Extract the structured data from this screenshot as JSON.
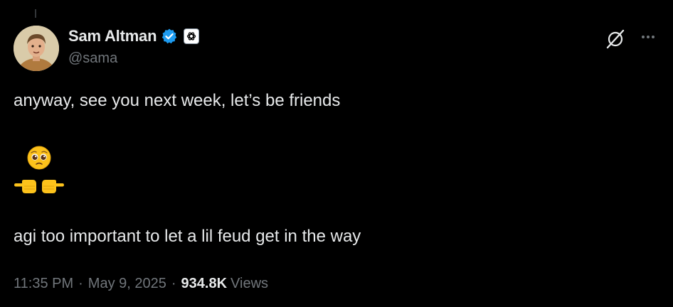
{
  "author": {
    "display_name": "Sam Altman",
    "handle": "@sama",
    "verified_badge_color": "#1d9bf0",
    "avatar_icon": "avatar",
    "affiliate_icon": "openai-logo-icon"
  },
  "header_actions": {
    "grok_icon": "grok-icon",
    "more_icon": "more-icon"
  },
  "tweet": {
    "line1": "anyway, see you next week, let’s be friends",
    "emoji_face": "pleading-face",
    "emoji_hands": "index-pointing-at-each-other",
    "line2": "agi too important to let a lil feud get in the way"
  },
  "meta": {
    "time": "11:35 PM",
    "separator": "·",
    "date": "May 9, 2025",
    "views_count": "934.8K",
    "views_label": "Views"
  },
  "colors": {
    "background": "#000000",
    "primary_text": "#e7e9ea",
    "secondary_text": "#71767b"
  }
}
